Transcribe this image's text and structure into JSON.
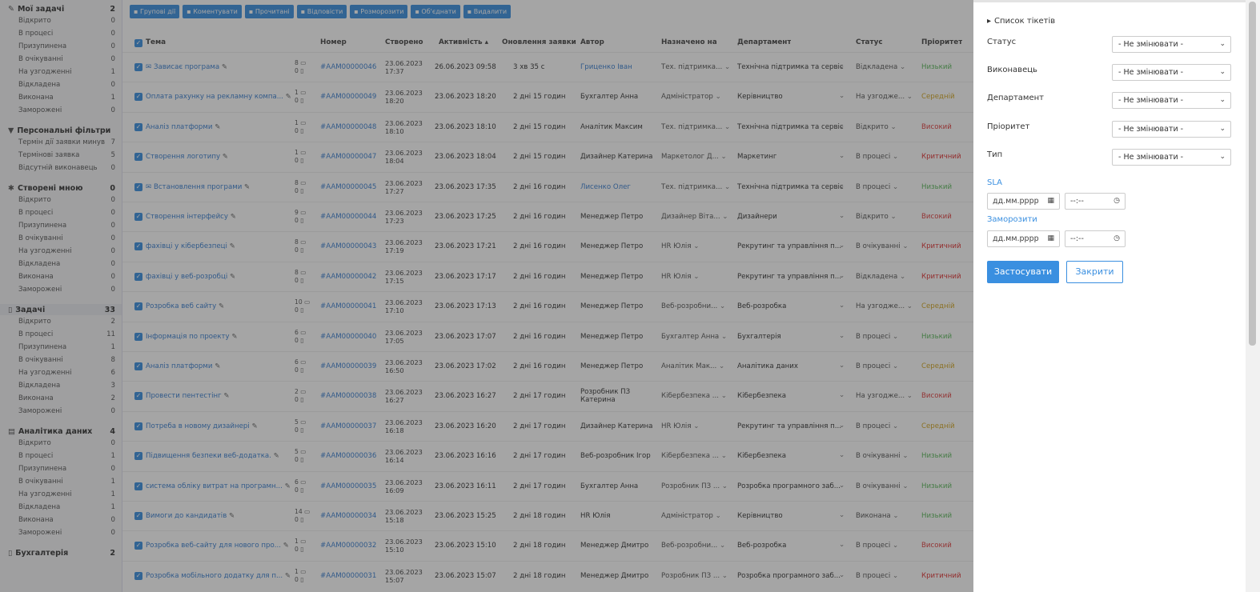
{
  "sidebar": {
    "sections": [
      {
        "icon": "pin-icon",
        "title": "Мої задачі",
        "count": "2",
        "items": [
          {
            "label": "Відкрито",
            "count": "0"
          },
          {
            "label": "В процесі",
            "count": "0"
          },
          {
            "label": "Призупинена",
            "count": "0"
          },
          {
            "label": "В очікуванні",
            "count": "0"
          },
          {
            "label": "На узгодженні",
            "count": "1"
          },
          {
            "label": "Відкладена",
            "count": "0"
          },
          {
            "label": "Виконана",
            "count": "1"
          },
          {
            "label": "Заморожені",
            "count": "0"
          }
        ]
      },
      {
        "icon": "filter-icon",
        "title": "Персональні фільтри",
        "count": "",
        "items": [
          {
            "label": "Термін дії заявки минув",
            "count": "7"
          },
          {
            "label": "Терміновi заявка",
            "count": "5"
          },
          {
            "label": "Відсутній виконавець",
            "count": "0"
          }
        ]
      },
      {
        "icon": "chat-icon",
        "title": "Створені мною",
        "count": "0",
        "items": [
          {
            "label": "Відкрито",
            "count": "0"
          },
          {
            "label": "В процесі",
            "count": "0"
          },
          {
            "label": "Призупинена",
            "count": "0"
          },
          {
            "label": "В очікуванні",
            "count": "0"
          },
          {
            "label": "На узгодженні",
            "count": "0"
          },
          {
            "label": "Відкладена",
            "count": "0"
          },
          {
            "label": "Виконана",
            "count": "0"
          },
          {
            "label": "Заморожені",
            "count": "0"
          }
        ]
      },
      {
        "icon": "doc-icon",
        "title": "Задачі",
        "count": "33",
        "highlight": true,
        "items": [
          {
            "label": "Відкрито",
            "count": "2"
          },
          {
            "label": "В процесі",
            "count": "11"
          },
          {
            "label": "Призупинена",
            "count": "1"
          },
          {
            "label": "В очікуванні",
            "count": "8"
          },
          {
            "label": "На узгодженні",
            "count": "6"
          },
          {
            "label": "Відкладена",
            "count": "3"
          },
          {
            "label": "Виконана",
            "count": "2"
          },
          {
            "label": "Заморожені",
            "count": "0"
          }
        ]
      },
      {
        "icon": "db-icon",
        "title": "Аналітика даних",
        "count": "4",
        "items": [
          {
            "label": "Відкрито",
            "count": "0"
          },
          {
            "label": "В процесі",
            "count": "1"
          },
          {
            "label": "Призупинена",
            "count": "0"
          },
          {
            "label": "В очікуванні",
            "count": "1"
          },
          {
            "label": "На узгодженні",
            "count": "1"
          },
          {
            "label": "Відкладена",
            "count": "1"
          },
          {
            "label": "Виконана",
            "count": "0"
          },
          {
            "label": "Заморожені",
            "count": "0"
          }
        ]
      },
      {
        "icon": "doc-icon",
        "title": "Бухгалтерія",
        "count": "2",
        "items": []
      }
    ]
  },
  "toolbar": [
    "Групові дії",
    "Коментувати",
    "Прочитані",
    "Відповісти",
    "Розморозити",
    "Об'єднати",
    "Видалити"
  ],
  "table": {
    "headers": {
      "subject": "Тема",
      "number": "Номер",
      "created": "Створено",
      "activity": "Активність",
      "updated": "Оновлення заявки",
      "author": "Автор",
      "assigned": "Назначено на",
      "department": "Департамент",
      "status": "Статус",
      "priority": "Пріоритет"
    },
    "rows": [
      {
        "subject": "Зависає програма",
        "mail": true,
        "c1": "8",
        "c2": "0",
        "number": "#AAM00000046",
        "cdate": "23.06.2023",
        "ctime": "17:37",
        "activity": "26.06.2023 09:58",
        "updated": "3 хв 35 с",
        "author": "Гриценко Іван",
        "authorLink": true,
        "assigned": "Тех. підтримка...",
        "department": "Технічна підтримка та сервіс",
        "status": "Відкладена",
        "priority": "Низький",
        "pclass": "p-low"
      },
      {
        "subject": "Оплата рахунку на рекламну компа...",
        "c1": "1",
        "c2": "0",
        "number": "#AAM00000049",
        "cdate": "23.06.2023",
        "ctime": "18:20",
        "activity": "23.06.2023 18:20",
        "updated": "2 дні 15 годин",
        "author": "Бухгалтер Анна",
        "assigned": "Адміністратор",
        "department": "Керівництво",
        "status": "На узгодже...",
        "priority": "Середній",
        "pclass": "p-mid"
      },
      {
        "subject": "Аналіз платформи",
        "c1": "1",
        "c2": "0",
        "number": "#AAM00000048",
        "cdate": "23.06.2023",
        "ctime": "18:10",
        "activity": "23.06.2023 18:10",
        "updated": "2 дні 15 годин",
        "author": "Аналітик Максим",
        "assigned": "Тех. підтримка...",
        "department": "Технічна підтримка та сервіс",
        "status": "Відкрито",
        "priority": "Високий",
        "pclass": "p-high"
      },
      {
        "subject": "Створення логотипу",
        "c1": "1",
        "c2": "0",
        "number": "#AAM00000047",
        "cdate": "23.06.2023",
        "ctime": "18:04",
        "activity": "23.06.2023 18:04",
        "updated": "2 дні 15 годин",
        "author": "Дизайнер Катерина",
        "assigned": "Маркетолог Д...",
        "department": "Маркетинг",
        "status": "В процесі",
        "priority": "Критичний",
        "pclass": "p-crit"
      },
      {
        "subject": "Встановлення програми",
        "mail": true,
        "c1": "8",
        "c2": "0",
        "number": "#AAM00000045",
        "cdate": "23.06.2023",
        "ctime": "17:27",
        "activity": "23.06.2023 17:35",
        "updated": "2 дні 16 годин",
        "author": "Лисенко Олег",
        "authorLink": true,
        "assigned": "Тех. підтримка...",
        "department": "Технічна підтримка та сервіс",
        "status": "В процесі",
        "priority": "Низький",
        "pclass": "p-low"
      },
      {
        "subject": "Створення інтерфейсу",
        "c1": "9",
        "c2": "0",
        "number": "#AAM00000044",
        "cdate": "23.06.2023",
        "ctime": "17:23",
        "activity": "23.06.2023 17:25",
        "updated": "2 дні 16 годин",
        "author": "Менеджер Петро",
        "assigned": "Дизайнер Віта...",
        "department": "Дизайнери",
        "status": "Відкрито",
        "priority": "Високий",
        "pclass": "p-high"
      },
      {
        "subject": "фахівці у кібербезпеці",
        "c1": "8",
        "c2": "0",
        "number": "#AAM00000043",
        "cdate": "23.06.2023",
        "ctime": "17:19",
        "activity": "23.06.2023 17:21",
        "updated": "2 дні 16 годин",
        "author": "Менеджер Петро",
        "assigned": "HR Юлія",
        "department": "Рекрутинг та управління п...",
        "status": "В очікуванні",
        "priority": "Критичний",
        "pclass": "p-crit"
      },
      {
        "subject": "фахівці у веб-розробці",
        "c1": "8",
        "c2": "0",
        "number": "#AAM00000042",
        "cdate": "23.06.2023",
        "ctime": "17:15",
        "activity": "23.06.2023 17:17",
        "updated": "2 дні 16 годин",
        "author": "Менеджер Петро",
        "assigned": "HR Юлія",
        "department": "Рекрутинг та управління п...",
        "status": "Відкладена",
        "priority": "Критичний",
        "pclass": "p-crit"
      },
      {
        "subject": "Розробка веб сайту",
        "c1": "10",
        "c2": "0",
        "number": "#AAM00000041",
        "cdate": "23.06.2023",
        "ctime": "17:10",
        "activity": "23.06.2023 17:13",
        "updated": "2 дні 16 годин",
        "author": "Менеджер Петро",
        "assigned": "Веб-розробни...",
        "department": "Веб-розробка",
        "status": "На узгодже...",
        "priority": "Середній",
        "pclass": "p-mid"
      },
      {
        "subject": "Інформація по проекту",
        "c1": "6",
        "c2": "0",
        "number": "#AAM00000040",
        "cdate": "23.06.2023",
        "ctime": "17:05",
        "activity": "23.06.2023 17:07",
        "updated": "2 дні 16 годин",
        "author": "Менеджер Петро",
        "assigned": "Бухгалтер Анна",
        "department": "Бухгалтерія",
        "status": "В процесі",
        "priority": "Низький",
        "pclass": "p-low"
      },
      {
        "subject": "Аналіз платформи",
        "c1": "6",
        "c2": "0",
        "number": "#AAM00000039",
        "cdate": "23.06.2023",
        "ctime": "16:50",
        "activity": "23.06.2023 17:02",
        "updated": "2 дні 16 годин",
        "author": "Менеджер Петро",
        "assigned": "Аналітик Мак...",
        "department": "Аналітика даних",
        "status": "В процесі",
        "priority": "Середній",
        "pclass": "p-mid"
      },
      {
        "subject": "Провести пентестінг",
        "c1": "2",
        "c2": "0",
        "number": "#AAM00000038",
        "cdate": "23.06.2023",
        "ctime": "16:27",
        "activity": "23.06.2023 16:27",
        "updated": "2 дні 17 годин",
        "author": "Розробник ПЗ Катерина",
        "assigned": "Кібербезпека ...",
        "department": "Кібербезпека",
        "status": "На узгодже...",
        "priority": "Високий",
        "pclass": "p-high"
      },
      {
        "subject": "Потреба в новому дизайнері",
        "c1": "5",
        "c2": "0",
        "number": "#AAM00000037",
        "cdate": "23.06.2023",
        "ctime": "16:18",
        "activity": "23.06.2023 16:20",
        "updated": "2 дні 17 годин",
        "author": "Дизайнер Катерина",
        "assigned": "HR Юлія",
        "department": "Рекрутинг та управління п...",
        "status": "В процесі",
        "priority": "Середній",
        "pclass": "p-mid"
      },
      {
        "subject": "Підвищення безпеки веб-додатка.",
        "c1": "5",
        "c2": "0",
        "number": "#AAM00000036",
        "cdate": "23.06.2023",
        "ctime": "16:14",
        "activity": "23.06.2023 16:16",
        "updated": "2 дні 17 годин",
        "author": "Веб-розробник Ігор",
        "assigned": "Кібербезпека ...",
        "department": "Кібербезпека",
        "status": "В очікуванні",
        "priority": "Низький",
        "pclass": "p-low"
      },
      {
        "subject": "система обліку витрат на програмн...",
        "c1": "6",
        "c2": "0",
        "number": "#AAM00000035",
        "cdate": "23.06.2023",
        "ctime": "16:09",
        "activity": "23.06.2023 16:11",
        "updated": "2 дні 17 годин",
        "author": "Бухгалтер Анна",
        "assigned": "Розробник ПЗ ...",
        "department": "Розробка програмного заб...",
        "status": "В очікуванні",
        "priority": "Низький",
        "pclass": "p-low"
      },
      {
        "subject": "Вимоги до кандидатів",
        "c1": "14",
        "c2": "0",
        "number": "#AAM00000034",
        "cdate": "23.06.2023",
        "ctime": "15:18",
        "activity": "23.06.2023 15:25",
        "updated": "2 дні 18 годин",
        "author": "HR Юлія",
        "assigned": "Адміністратор",
        "department": "Керівництво",
        "status": "Виконана",
        "priority": "Низький",
        "pclass": "p-low"
      },
      {
        "subject": "Розробка веб-сайту для нового про...",
        "c1": "1",
        "c2": "0",
        "number": "#AAM00000032",
        "cdate": "23.06.2023",
        "ctime": "15:10",
        "activity": "23.06.2023 15:10",
        "updated": "2 дні 18 годин",
        "author": "Менеджер Дмитро",
        "assigned": "Веб-розробни...",
        "department": "Веб-розробка",
        "status": "В процесі",
        "priority": "Високий",
        "pclass": "p-high"
      },
      {
        "subject": "Розробка мобільного додатку для п...",
        "c1": "1",
        "c2": "0",
        "number": "#AAM00000031",
        "cdate": "23.06.2023",
        "ctime": "15:07",
        "activity": "23.06.2023 15:07",
        "updated": "2 дні 18 годин",
        "author": "Менеджер Дмитро",
        "assigned": "Розробник ПЗ ...",
        "department": "Розробка програмного заб...",
        "status": "В процесі",
        "priority": "Критичний",
        "pclass": "p-crit"
      }
    ]
  },
  "panel": {
    "title": "Список тікетів",
    "fields": [
      {
        "label": "Статус",
        "value": "- Не змінювати -"
      },
      {
        "label": "Виконавець",
        "value": "- Не змінювати -"
      },
      {
        "label": "Департамент",
        "value": "- Не змінювати -"
      },
      {
        "label": "Пріоритет",
        "value": "- Не змінювати -"
      },
      {
        "label": "Тип",
        "value": "- Не змінювати -"
      }
    ],
    "sla_label": "SLA",
    "freeze_label": "Заморозити",
    "date_placeholder": "дд.мм.рррр",
    "time_placeholder": "--:--",
    "apply": "Застосувати",
    "close": "Закрити"
  }
}
